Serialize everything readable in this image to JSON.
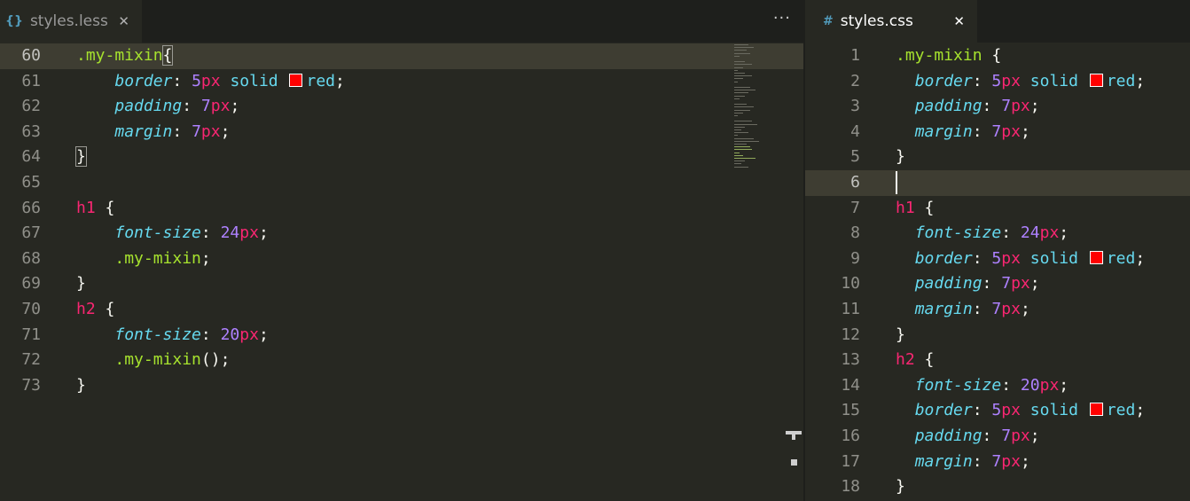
{
  "left_editor": {
    "tab": {
      "icon": "{}",
      "title": "styles.less",
      "close": "✕",
      "icon_color": "#519aba"
    },
    "more_actions": "···",
    "lines": [
      {
        "n": "60",
        "current": true,
        "tokens": [
          [
            "selector",
            ".my-mixin"
          ],
          [
            "punct-match",
            "{"
          ]
        ]
      },
      {
        "n": "61",
        "tokens": [
          [
            "sp",
            "    "
          ],
          [
            "prop",
            "border"
          ],
          [
            "punct",
            ": "
          ],
          [
            "num",
            "5"
          ],
          [
            "unit",
            "px"
          ],
          [
            "punct",
            " "
          ],
          [
            "val",
            "solid"
          ],
          [
            "punct",
            " "
          ],
          [
            "swatch",
            "#ff0000"
          ],
          [
            "val",
            "red"
          ],
          [
            "punct",
            ";"
          ]
        ]
      },
      {
        "n": "62",
        "tokens": [
          [
            "sp",
            "    "
          ],
          [
            "prop",
            "padding"
          ],
          [
            "punct",
            ": "
          ],
          [
            "num",
            "7"
          ],
          [
            "unit",
            "px"
          ],
          [
            "punct",
            ";"
          ]
        ]
      },
      {
        "n": "63",
        "tokens": [
          [
            "sp",
            "    "
          ],
          [
            "prop",
            "margin"
          ],
          [
            "punct",
            ": "
          ],
          [
            "num",
            "7"
          ],
          [
            "unit",
            "px"
          ],
          [
            "punct",
            ";"
          ]
        ]
      },
      {
        "n": "64",
        "tokens": [
          [
            "punct-match",
            "}"
          ]
        ]
      },
      {
        "n": "65",
        "tokens": []
      },
      {
        "n": "66",
        "tokens": [
          [
            "tag",
            "h1"
          ],
          [
            "punct",
            " {"
          ]
        ]
      },
      {
        "n": "67",
        "tokens": [
          [
            "sp",
            "    "
          ],
          [
            "prop",
            "font-size"
          ],
          [
            "punct",
            ": "
          ],
          [
            "num",
            "24"
          ],
          [
            "unit",
            "px"
          ],
          [
            "punct",
            ";"
          ]
        ]
      },
      {
        "n": "68",
        "tokens": [
          [
            "sp",
            "    "
          ],
          [
            "selector",
            ".my-mixin"
          ],
          [
            "punct",
            ";"
          ]
        ]
      },
      {
        "n": "69",
        "tokens": [
          [
            "punct",
            "}"
          ]
        ]
      },
      {
        "n": "70",
        "tokens": [
          [
            "tag",
            "h2"
          ],
          [
            "punct",
            " {"
          ]
        ]
      },
      {
        "n": "71",
        "tokens": [
          [
            "sp",
            "    "
          ],
          [
            "prop",
            "font-size"
          ],
          [
            "punct",
            ": "
          ],
          [
            "num",
            "20"
          ],
          [
            "unit",
            "px"
          ],
          [
            "punct",
            ";"
          ]
        ]
      },
      {
        "n": "72",
        "tokens": [
          [
            "sp",
            "    "
          ],
          [
            "selector",
            ".my-mixin"
          ],
          [
            "punct",
            "();"
          ]
        ]
      },
      {
        "n": "73",
        "tokens": [
          [
            "punct",
            "}"
          ]
        ]
      }
    ]
  },
  "right_editor": {
    "tab": {
      "icon": "#",
      "title": "styles.css",
      "close": "✕",
      "icon_color": "#519aba"
    },
    "lines": [
      {
        "n": "1",
        "tokens": [
          [
            "selector",
            ".my-mixin"
          ],
          [
            "punct",
            " {"
          ]
        ]
      },
      {
        "n": "2",
        "tokens": [
          [
            "sp",
            "  "
          ],
          [
            "prop",
            "border"
          ],
          [
            "punct",
            ": "
          ],
          [
            "num",
            "5"
          ],
          [
            "unit",
            "px"
          ],
          [
            "punct",
            " "
          ],
          [
            "val",
            "solid"
          ],
          [
            "punct",
            " "
          ],
          [
            "swatch",
            "#ff0000"
          ],
          [
            "val",
            "red"
          ],
          [
            "punct",
            ";"
          ]
        ]
      },
      {
        "n": "3",
        "tokens": [
          [
            "sp",
            "  "
          ],
          [
            "prop",
            "padding"
          ],
          [
            "punct",
            ": "
          ],
          [
            "num",
            "7"
          ],
          [
            "unit",
            "px"
          ],
          [
            "punct",
            ";"
          ]
        ]
      },
      {
        "n": "4",
        "tokens": [
          [
            "sp",
            "  "
          ],
          [
            "prop",
            "margin"
          ],
          [
            "punct",
            ": "
          ],
          [
            "num",
            "7"
          ],
          [
            "unit",
            "px"
          ],
          [
            "punct",
            ";"
          ]
        ]
      },
      {
        "n": "5",
        "tokens": [
          [
            "punct",
            "}"
          ]
        ]
      },
      {
        "n": "6",
        "current": true,
        "tokens": [
          [
            "cursor",
            ""
          ]
        ]
      },
      {
        "n": "7",
        "tokens": [
          [
            "tag",
            "h1"
          ],
          [
            "punct",
            " {"
          ]
        ]
      },
      {
        "n": "8",
        "tokens": [
          [
            "sp",
            "  "
          ],
          [
            "prop",
            "font-size"
          ],
          [
            "punct",
            ": "
          ],
          [
            "num",
            "24"
          ],
          [
            "unit",
            "px"
          ],
          [
            "punct",
            ";"
          ]
        ]
      },
      {
        "n": "9",
        "tokens": [
          [
            "sp",
            "  "
          ],
          [
            "prop",
            "border"
          ],
          [
            "punct",
            ": "
          ],
          [
            "num",
            "5"
          ],
          [
            "unit",
            "px"
          ],
          [
            "punct",
            " "
          ],
          [
            "val",
            "solid"
          ],
          [
            "punct",
            " "
          ],
          [
            "swatch",
            "#ff0000"
          ],
          [
            "val",
            "red"
          ],
          [
            "punct",
            ";"
          ]
        ]
      },
      {
        "n": "10",
        "tokens": [
          [
            "sp",
            "  "
          ],
          [
            "prop",
            "padding"
          ],
          [
            "punct",
            ": "
          ],
          [
            "num",
            "7"
          ],
          [
            "unit",
            "px"
          ],
          [
            "punct",
            ";"
          ]
        ]
      },
      {
        "n": "11",
        "tokens": [
          [
            "sp",
            "  "
          ],
          [
            "prop",
            "margin"
          ],
          [
            "punct",
            ": "
          ],
          [
            "num",
            "7"
          ],
          [
            "unit",
            "px"
          ],
          [
            "punct",
            ";"
          ]
        ]
      },
      {
        "n": "12",
        "tokens": [
          [
            "punct",
            "}"
          ]
        ]
      },
      {
        "n": "13",
        "tokens": [
          [
            "tag",
            "h2"
          ],
          [
            "punct",
            " {"
          ]
        ]
      },
      {
        "n": "14",
        "tokens": [
          [
            "sp",
            "  "
          ],
          [
            "prop",
            "font-size"
          ],
          [
            "punct",
            ": "
          ],
          [
            "num",
            "20"
          ],
          [
            "unit",
            "px"
          ],
          [
            "punct",
            ";"
          ]
        ]
      },
      {
        "n": "15",
        "tokens": [
          [
            "sp",
            "  "
          ],
          [
            "prop",
            "border"
          ],
          [
            "punct",
            ": "
          ],
          [
            "num",
            "5"
          ],
          [
            "unit",
            "px"
          ],
          [
            "punct",
            " "
          ],
          [
            "val",
            "solid"
          ],
          [
            "punct",
            " "
          ],
          [
            "swatch",
            "#ff0000"
          ],
          [
            "val",
            "red"
          ],
          [
            "punct",
            ";"
          ]
        ]
      },
      {
        "n": "16",
        "tokens": [
          [
            "sp",
            "  "
          ],
          [
            "prop",
            "padding"
          ],
          [
            "punct",
            ": "
          ],
          [
            "num",
            "7"
          ],
          [
            "unit",
            "px"
          ],
          [
            "punct",
            ";"
          ]
        ]
      },
      {
        "n": "17",
        "tokens": [
          [
            "sp",
            "  "
          ],
          [
            "prop",
            "margin"
          ],
          [
            "punct",
            ": "
          ],
          [
            "num",
            "7"
          ],
          [
            "unit",
            "px"
          ],
          [
            "punct",
            ";"
          ]
        ]
      },
      {
        "n": "18",
        "tokens": [
          [
            "punct",
            "}"
          ]
        ]
      }
    ]
  },
  "theme": {
    "background": "#272822",
    "current_line": "#3e3d32",
    "selector": "#a6e22e",
    "tag": "#f92672",
    "property": "#66d9ef",
    "number": "#ae81ff"
  }
}
